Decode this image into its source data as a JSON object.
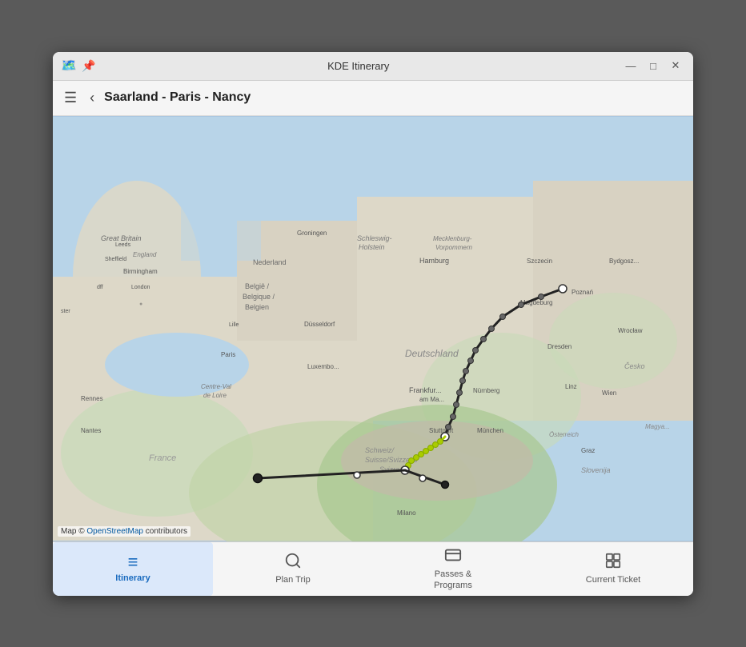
{
  "window": {
    "title": "KDE Itinerary",
    "icon_symbol": "🗺️",
    "pin_symbol": "📌",
    "btn_minimize": "—",
    "btn_maximize": "□",
    "btn_close": "✕"
  },
  "nav": {
    "title": "Saarland - Paris - Nancy",
    "hamburger_symbol": "☰",
    "back_symbol": "‹"
  },
  "map": {
    "attribution_text": "Map © ",
    "attribution_link_text": "OpenStreetMap",
    "attribution_suffix": " contributors"
  },
  "tabs": [
    {
      "id": "itinerary",
      "label": "Itinerary",
      "icon": "≡",
      "active": true
    },
    {
      "id": "plan-trip",
      "label": "Plan Trip",
      "icon": "🔍",
      "active": false
    },
    {
      "id": "passes-programs",
      "label": "Passes &\nPrograms",
      "icon": "🎫",
      "active": false
    },
    {
      "id": "current-ticket",
      "label": "Current Ticket",
      "icon": "▦",
      "active": false
    }
  ],
  "map_colors": {
    "water": "#b8d4e8",
    "land_light": "#e8e0d0",
    "land_green": "#c8dbb8",
    "border_dark": "#888",
    "route_black": "#222",
    "route_green": "#aacc00",
    "dot_white": "#ffffff",
    "dot_dark": "#555555"
  }
}
